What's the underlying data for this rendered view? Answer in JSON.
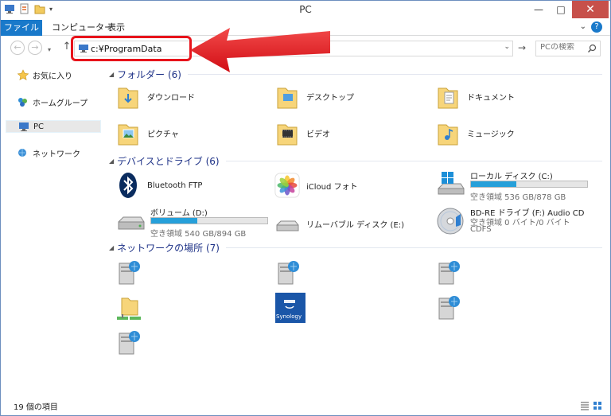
{
  "window": {
    "title": "PC",
    "controls": {
      "minimize": "—",
      "maximize": "□",
      "close": "✕"
    }
  },
  "ribbon": {
    "file_tab": "ファイル",
    "computer_tab": "コンピューター",
    "view_tab": "表示",
    "help": "?"
  },
  "address": {
    "value": "c:¥ProgramData",
    "search_placeholder": "PCの検索"
  },
  "sidebar": {
    "items": [
      {
        "label": "お気に入り",
        "icon": "star-icon"
      },
      {
        "label": "ホームグループ",
        "icon": "homegroup-icon"
      },
      {
        "label": "PC",
        "icon": "pc-icon"
      },
      {
        "label": "ネットワーク",
        "icon": "network-icon"
      }
    ]
  },
  "groups": {
    "folders": "フォルダー (6)",
    "drives": "デバイスとドライブ (6)",
    "network": "ネットワークの場所 (7)"
  },
  "folders": [
    {
      "label": "ダウンロード",
      "icon": "downloads-folder-icon"
    },
    {
      "label": "デスクトップ",
      "icon": "desktop-folder-icon"
    },
    {
      "label": "ドキュメント",
      "icon": "documents-folder-icon"
    },
    {
      "label": "ピクチャ",
      "icon": "pictures-folder-icon"
    },
    {
      "label": "ビデオ",
      "icon": "videos-folder-icon"
    },
    {
      "label": "ミュージック",
      "icon": "music-folder-icon"
    }
  ],
  "drives": [
    {
      "name": "Bluetooth FTP",
      "icon": "bluetooth-icon"
    },
    {
      "name": "iCloud フォト",
      "icon": "icloud-photos-icon"
    },
    {
      "name": "ローカル ディスク (C:)",
      "icon": "local-disk-icon",
      "usage_fraction": 0.39,
      "sub": "空き領域 536 GB/878 GB"
    },
    {
      "name": "ボリューム (D:)",
      "icon": "volume-disk-icon",
      "usage_fraction": 0.4,
      "sub": "空き領域 540 GB/894 GB"
    },
    {
      "name": "リムーバブル ディスク (E:)",
      "icon": "removable-disk-icon"
    },
    {
      "name": "BD-RE ドライブ (F:) Audio CD",
      "icon": "bd-drive-icon",
      "sub": "空き領域 0 バイト/0 バイト",
      "sub2": "CDFS"
    }
  ],
  "network_locations": [
    {
      "icon": "network-server-icon"
    },
    {
      "icon": "network-server-icon"
    },
    {
      "icon": "network-server-icon"
    },
    {
      "icon": "network-folder-icon"
    },
    {
      "icon": "synology-icon",
      "label": "Synology"
    },
    {
      "icon": "network-server-icon"
    },
    {
      "icon": "network-server-icon"
    }
  ],
  "status": {
    "count": "19 個の項目"
  },
  "colors": {
    "accent": "#1979ca",
    "group_header": "#1e3287",
    "highlight": "#e8131b",
    "drive_fill": "#26a0da"
  }
}
